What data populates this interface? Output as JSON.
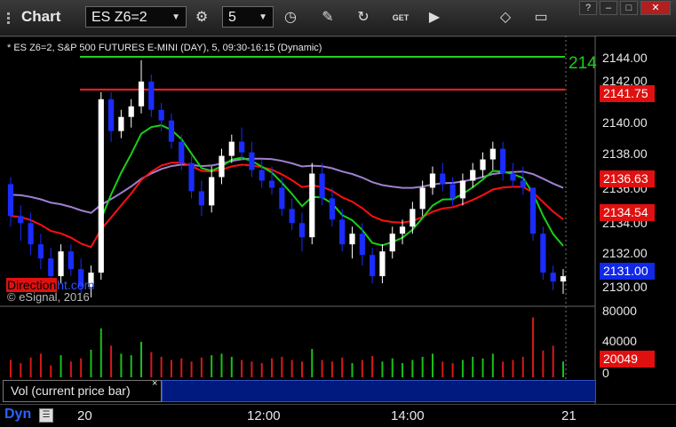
{
  "window": {
    "title": "Chart",
    "symbol": "ES Z6=2",
    "interval": "5",
    "controls": [
      "?",
      "–",
      "□",
      "✕"
    ]
  },
  "toolbar": {
    "icons": [
      "settings-gear-icon",
      "clock-icon",
      "pencil-icon",
      "refresh-icon",
      "get-icon",
      "play-icon",
      "diamond-tool-icon",
      "comment-icon"
    ]
  },
  "legend": "* ES Z6=2, S&P 500 FUTURES E-MINI (DAY), 5, 09:30-16:15 (Dynamic)",
  "branding": {
    "logo_box": "Direction",
    "logo_rest": "ht.com",
    "copyright": "© eSignal, 2016"
  },
  "line_label": "214",
  "volume_panel": {
    "label": "Vol (current price bar)",
    "close": "×"
  },
  "bottom": {
    "dyn": "Dyn",
    "x_ticks": [
      "20",
      "12:00",
      "14:00",
      "21"
    ]
  },
  "price_axis": {
    "ticks": [
      "2144.00",
      "2142.00",
      "2140.00",
      "2138.00",
      "2136.00",
      "2134.00",
      "2132.00",
      "2130.00"
    ]
  },
  "tags": [
    {
      "label": "2141.75",
      "color": "#e01010"
    },
    {
      "label": "2136.63",
      "color": "#e01010"
    },
    {
      "label": "2134.54",
      "color": "#e01010"
    },
    {
      "label": "2131.00",
      "color": "#1028e8"
    }
  ],
  "volume_axis": {
    "ticks": [
      "80000",
      "40000",
      "0"
    ],
    "tag": "20049",
    "tag_color": "#e01010"
  },
  "colors": {
    "up": "#ffffff",
    "down": "#1a2cff",
    "ma_red": "#ff1010",
    "ma_green": "#18d018",
    "ma_purple": "#a080d0",
    "hline_green": "#20d020",
    "hline_red": "#ff2020"
  },
  "chart_data": {
    "type": "candlestick",
    "price_range": [
      2129.5,
      2144.5
    ],
    "volume_range": [
      0,
      80000
    ],
    "reference_lines": [
      {
        "price": 2143.6,
        "color": "green"
      },
      {
        "price": 2141.75,
        "color": "red"
      }
    ],
    "candles": [
      [
        2136.4,
        2136.8,
        2134.0,
        2134.6
      ],
      [
        2134.6,
        2135.2,
        2133.2,
        2134.2
      ],
      [
        2134.2,
        2134.8,
        2132.4,
        2133.0
      ],
      [
        2133.0,
        2133.6,
        2131.6,
        2132.2
      ],
      [
        2132.2,
        2132.8,
        2130.6,
        2131.2
      ],
      [
        2131.2,
        2133.0,
        2130.8,
        2132.6
      ],
      [
        2132.6,
        2133.0,
        2131.2,
        2131.6
      ],
      [
        2131.6,
        2132.2,
        2130.2,
        2130.6
      ],
      [
        2130.6,
        2131.8,
        2130.0,
        2131.4
      ],
      [
        2131.4,
        2141.6,
        2131.0,
        2141.2
      ],
      [
        2141.2,
        2141.6,
        2138.8,
        2139.4
      ],
      [
        2139.4,
        2140.6,
        2139.0,
        2140.2
      ],
      [
        2140.2,
        2141.2,
        2139.6,
        2140.8
      ],
      [
        2140.8,
        2143.4,
        2140.4,
        2142.2
      ],
      [
        2142.2,
        2142.6,
        2140.2,
        2140.6
      ],
      [
        2140.6,
        2141.0,
        2139.4,
        2140.0
      ],
      [
        2140.0,
        2140.4,
        2138.4,
        2138.8
      ],
      [
        2138.8,
        2139.2,
        2137.2,
        2137.6
      ],
      [
        2137.6,
        2138.0,
        2135.6,
        2136.0
      ],
      [
        2136.0,
        2136.6,
        2134.6,
        2135.2
      ],
      [
        2135.2,
        2137.4,
        2134.8,
        2136.8
      ],
      [
        2136.8,
        2138.4,
        2136.4,
        2138.0
      ],
      [
        2138.0,
        2139.2,
        2137.6,
        2138.8
      ],
      [
        2138.8,
        2139.6,
        2137.8,
        2138.2
      ],
      [
        2138.2,
        2138.8,
        2136.8,
        2137.2
      ],
      [
        2137.2,
        2137.8,
        2136.2,
        2136.6
      ],
      [
        2136.6,
        2137.4,
        2135.8,
        2136.2
      ],
      [
        2136.2,
        2136.8,
        2134.6,
        2135.0
      ],
      [
        2135.0,
        2135.6,
        2133.8,
        2134.2
      ],
      [
        2134.2,
        2134.8,
        2132.6,
        2133.4
      ],
      [
        2133.4,
        2137.6,
        2133.0,
        2137.0
      ],
      [
        2137.0,
        2137.6,
        2135.2,
        2135.6
      ],
      [
        2135.6,
        2136.2,
        2134.0,
        2134.4
      ],
      [
        2134.4,
        2135.0,
        2132.6,
        2133.0
      ],
      [
        2133.0,
        2134.0,
        2132.2,
        2133.6
      ],
      [
        2133.6,
        2134.2,
        2131.8,
        2132.4
      ],
      [
        2132.4,
        2132.8,
        2130.8,
        2131.2
      ],
      [
        2131.2,
        2133.0,
        2130.8,
        2132.6
      ],
      [
        2132.6,
        2134.0,
        2132.2,
        2133.6
      ],
      [
        2133.6,
        2134.4,
        2133.0,
        2134.0
      ],
      [
        2134.0,
        2135.4,
        2133.6,
        2135.0
      ],
      [
        2135.0,
        2136.6,
        2134.6,
        2136.2
      ],
      [
        2136.2,
        2137.4,
        2135.8,
        2137.0
      ],
      [
        2137.0,
        2137.6,
        2136.0,
        2136.4
      ],
      [
        2136.4,
        2136.8,
        2135.2,
        2135.6
      ],
      [
        2135.6,
        2137.0,
        2135.2,
        2136.6
      ],
      [
        2136.6,
        2137.6,
        2136.2,
        2137.2
      ],
      [
        2137.2,
        2138.2,
        2136.8,
        2137.8
      ],
      [
        2137.8,
        2138.8,
        2137.2,
        2138.4
      ],
      [
        2138.4,
        2138.8,
        2136.6,
        2137.0
      ],
      [
        2137.0,
        2137.6,
        2136.2,
        2136.6
      ],
      [
        2136.6,
        2137.4,
        2135.8,
        2136.2
      ],
      [
        2136.2,
        2135.8,
        2133.2,
        2133.6
      ],
      [
        2133.6,
        2134.0,
        2131.0,
        2131.4
      ],
      [
        2131.4,
        2131.8,
        2130.4,
        2130.9
      ],
      [
        2130.9,
        2131.6,
        2130.2,
        2131.2
      ]
    ],
    "volumes": [
      22000,
      18000,
      25000,
      30000,
      15000,
      28000,
      20000,
      24000,
      35000,
      62000,
      40000,
      30000,
      28000,
      45000,
      32000,
      26000,
      22000,
      24000,
      20000,
      25000,
      28000,
      30000,
      26000,
      22000,
      20000,
      18000,
      24000,
      26000,
      22000,
      20000,
      36000,
      22000,
      20000,
      25000,
      18000,
      22000,
      27000,
      20000,
      24000,
      18000,
      22000,
      26000,
      30000,
      20000,
      18000,
      22000,
      26000,
      24000,
      30000,
      20000,
      22000,
      26000,
      76000,
      34000,
      40000,
      20049
    ]
  }
}
